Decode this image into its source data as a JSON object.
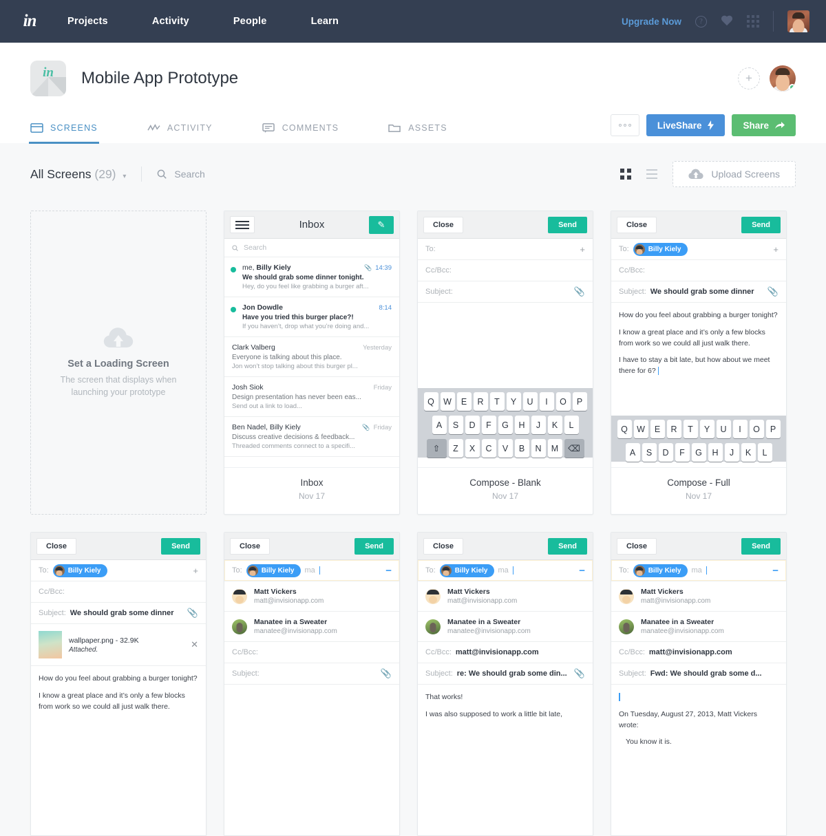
{
  "topnav": {
    "logo": "in",
    "links": [
      "Projects",
      "Activity",
      "People",
      "Learn"
    ],
    "upgrade_label": "Upgrade Now",
    "icons": [
      "help-icon",
      "heart-icon",
      "apps-grid-icon"
    ],
    "avatar": "user-avatar"
  },
  "project": {
    "title": "Mobile App Prototype",
    "thumb_logo": "in",
    "add_member_label": "+",
    "tabs": [
      {
        "label": "SCREENS",
        "icon": "screens-icon",
        "active": true
      },
      {
        "label": "ACTIVITY",
        "icon": "activity-icon",
        "active": false
      },
      {
        "label": "COMMENTS",
        "icon": "comments-icon",
        "active": false
      },
      {
        "label": "ASSETS",
        "icon": "assets-folder-icon",
        "active": false
      }
    ],
    "actions": {
      "more_label": "•••",
      "liveshare_label": "LiveShare",
      "share_label": "Share"
    }
  },
  "toolbar": {
    "all_screens_label": "All Screens",
    "count": "(29)",
    "caret": "⌄",
    "search_placeholder": "Search",
    "view_grid": "grid-view-icon",
    "view_list": "list-view-icon",
    "upload_label": "Upload Screens"
  },
  "cards": [
    {
      "type": "placeholder",
      "title": "Set a Loading Screen",
      "subtitle": "The screen that displays when launching your prototype"
    },
    {
      "type": "inbox",
      "name": "Inbox",
      "date": "Nov 17",
      "screen": {
        "menu_icon": "hamburger-icon",
        "title": "Inbox",
        "compose_icon": "pencil-icon",
        "search_placeholder": "Search",
        "mails": [
          {
            "from_plain": "me, ",
            "from_bold": "Billy Kiely",
            "subject": "We should grab some dinner tonight.",
            "preview": "Hey, do you feel like grabbing a burger aft...",
            "time": "14:39",
            "unread": true,
            "attachment": true
          },
          {
            "from_plain": "",
            "from_bold": "Jon Dowdle",
            "subject": "Have you tried this burger place?!",
            "preview": "If you haven’t, drop what you’re doing and...",
            "time": "8:14",
            "unread": true,
            "attachment": false
          },
          {
            "from_plain": "",
            "from_bold": "Clark Valberg",
            "subject": "Everyone is talking about this place.",
            "preview": "Jon won’t stop talking about this burger pl...",
            "time": "Yesterday",
            "unread": false,
            "attachment": false
          },
          {
            "from_plain": "",
            "from_bold": "Josh Siok",
            "subject": "Design presentation has never been eas...",
            "preview": "Send out a link to load...",
            "time": "Friday",
            "unread": false,
            "attachment": false
          },
          {
            "from_plain": "",
            "from_bold": "Ben Nadel, Billy Kiely",
            "subject": "Discuss creative decisions & feedback...",
            "preview": "Threaded comments connect to a specifi...",
            "time": "Friday",
            "unread": false,
            "attachment": true
          }
        ]
      }
    },
    {
      "type": "compose-blank",
      "name": "Compose - Blank",
      "date": "Nov 17",
      "screen": {
        "close_label": "Close",
        "send_label": "Send",
        "to_label": "To:",
        "cc_label": "Cc/Bcc:",
        "subject_label": "Subject:",
        "add_icon": "plus-icon",
        "clip_icon": "paperclip-icon"
      }
    },
    {
      "type": "compose-full",
      "name": "Compose - Full",
      "date": "Nov 17",
      "screen": {
        "close_label": "Close",
        "send_label": "Send",
        "to_label": "To:",
        "recipient": "Billy Kiely",
        "cc_label": "Cc/Bcc:",
        "subject_label": "Subject:",
        "subject_value": "We should grab some dinner",
        "body": [
          "How do you feel about grabbing a burger tonight?",
          "I know a great place and it’s only a few blocks from work so we could all just walk there.",
          "I have to stay a bit late, but how about we meet there for 6?"
        ]
      }
    },
    {
      "type": "compose-attached",
      "name": "",
      "date": "",
      "screen": {
        "close_label": "Close",
        "send_label": "Send",
        "to_label": "To:",
        "recipient": "Billy Kiely",
        "cc_label": "Cc/Bcc:",
        "subject_label": "Subject:",
        "subject_value": "We should grab some dinner",
        "attachment_name": "wallpaper.png - 32.9K",
        "attachment_status": "Attached.",
        "remove_icon": "close-x-icon",
        "body": [
          "How do you feel about grabbing a burger tonight?",
          "I know a great place and it’s only a few blocks from work so we could all just walk there."
        ]
      }
    },
    {
      "type": "compose-suggest",
      "name": "",
      "date": "",
      "screen": {
        "close_label": "Close",
        "send_label": "Send",
        "to_label": "To:",
        "recipient": "Billy Kiely",
        "typed": "ma",
        "collapse_icon": "minus-icon",
        "suggestions": [
          {
            "name": "Matt Vickers",
            "email": "matt@invisionapp.com",
            "avatar": "matt-avatar"
          },
          {
            "name": "Manatee in a Sweater",
            "email": "manatee@invisionapp.com",
            "avatar": "manatee-avatar"
          }
        ],
        "cc_label": "Cc/Bcc:",
        "subject_label": "Subject:",
        "subject_value": ""
      }
    },
    {
      "type": "compose-reply",
      "name": "",
      "date": "",
      "screen": {
        "close_label": "Close",
        "send_label": "Send",
        "to_label": "To:",
        "recipient": "Billy Kiely",
        "typed": "ma",
        "collapse_icon": "minus-icon",
        "suggestions": [
          {
            "name": "Matt Vickers",
            "email": "matt@invisionapp.com",
            "avatar": "matt-avatar"
          },
          {
            "name": "Manatee in a Sweater",
            "email": "manatee@invisionapp.com",
            "avatar": "manatee-avatar"
          }
        ],
        "cc_label": "Cc/Bcc:",
        "cc_value": "matt@invisionapp.com",
        "subject_label": "Subject:",
        "subject_value": "re: We should grab some din...",
        "body": [
          "That works!",
          "I was also supposed to work a little bit late,"
        ]
      }
    },
    {
      "type": "compose-forward",
      "name": "",
      "date": "",
      "screen": {
        "close_label": "Close",
        "send_label": "Send",
        "to_label": "To:",
        "recipient": "Billy Kiely",
        "typed": "ma",
        "collapse_icon": "minus-icon",
        "suggestions": [
          {
            "name": "Matt Vickers",
            "email": "matt@invisionapp.com",
            "avatar": "matt-avatar"
          },
          {
            "name": "Manatee in a Sweater",
            "email": "manatee@invisionapp.com",
            "avatar": "manatee-avatar"
          }
        ],
        "cc_label": "Cc/Bcc:",
        "cc_value": "matt@invisionapp.com",
        "subject_label": "Subject:",
        "subject_value": "Fwd: We should grab some d...",
        "quote_head": "On Tuesday, August 27, 2013, Matt Vickers wrote:",
        "quote_body": "You know it is."
      }
    }
  ],
  "keyboard": {
    "row1": [
      "Q",
      "W",
      "E",
      "R",
      "T",
      "Y",
      "U",
      "I",
      "O",
      "P"
    ],
    "row2": [
      "A",
      "S",
      "D",
      "F",
      "G",
      "H",
      "J",
      "K",
      "L"
    ],
    "row3": [
      "⇧",
      "Z",
      "X",
      "C",
      "V",
      "B",
      "N",
      "M",
      "⌫"
    ]
  },
  "colors": {
    "nav_bg": "#343f52",
    "accent_blue": "#4a90d9",
    "accent_green": "#5bbd72",
    "phone_green": "#18bc9c",
    "tab_active": "#4a90c4"
  }
}
